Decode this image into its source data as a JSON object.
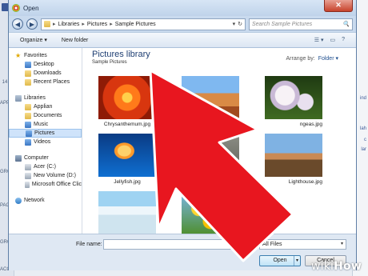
{
  "window": {
    "title": "Open",
    "close_glyph": "✕",
    "back_glyph": "◀",
    "forward_glyph": "▶"
  },
  "address": {
    "crumbs": [
      "Libraries",
      "Pictures",
      "Sample Pictures"
    ],
    "separator": "▸",
    "dropdown_glyph": "▾",
    "refresh_glyph": "↻",
    "search_placeholder": "Search Sample Pictures",
    "search_glyph": "🔍"
  },
  "toolbar": {
    "organize": "Organize ▾",
    "new_folder": "New folder",
    "view_glyph": "☰ ▾",
    "pane_glyph": "▭",
    "help_glyph": "?"
  },
  "nav": {
    "favorites": "Favorites",
    "desktop": "Desktop",
    "downloads": "Downloads",
    "recent": "Recent Places",
    "libraries": "Libraries",
    "applian": "Applian",
    "documents": "Documents",
    "music": "Music",
    "pictures": "Pictures",
    "videos": "Videos",
    "computer": "Computer",
    "acer": "Acer (C:)",
    "new_volume": "New Volume (D:)",
    "ms_office": "Microsoft Office Clic",
    "network": "Network"
  },
  "content": {
    "title": "Pictures library",
    "subtitle": "Sample Pictures",
    "arrange_label": "Arrange by:",
    "arrange_value": "Folder ▾",
    "files": [
      "Chrysanthemum.jpg",
      "",
      "ngeas.jpg",
      "Jellyfish.jpg",
      "",
      "Lighthouse.jpg"
    ]
  },
  "footer": {
    "file_name_label": "File name:",
    "file_name_value": "",
    "filter": "All Files",
    "filter_glyph": "▾",
    "open": "Open",
    "open_dropdown": "▾",
    "cancel": "Cancel"
  },
  "background": {
    "left_labels": [
      "14",
      "APPS",
      "GROUPS",
      "PAGES",
      "GROUPS",
      "ACC"
    ],
    "right_labels": [
      "ind",
      "lah",
      "c",
      "lar"
    ]
  },
  "watermark": {
    "prefix": "wiki",
    "suffix": "How"
  },
  "colors": {
    "arrow": "#e8161f",
    "accent": "#1f3f73"
  }
}
